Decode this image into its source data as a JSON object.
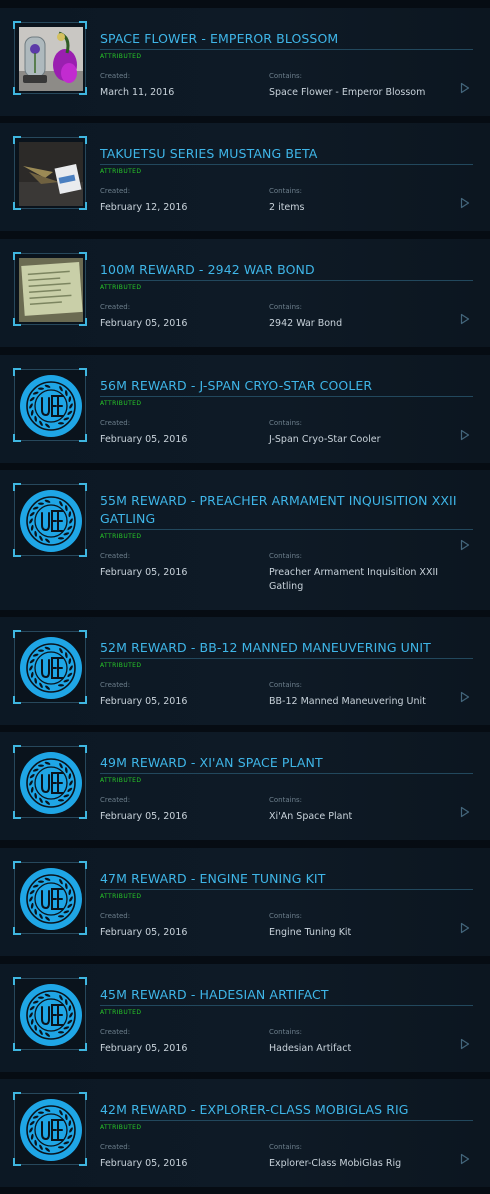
{
  "labels": {
    "status": "ATTRIBUTED",
    "created": "Created:",
    "contains": "Contains:"
  },
  "icons": {
    "expand": "play-arrow-icon",
    "uee_logo": "uee-emblem-icon"
  },
  "colors": {
    "title": "#3fb6e8",
    "status": "#28c928",
    "emblem": "#1fa6e6"
  },
  "items": [
    {
      "title": "SPACE FLOWER - EMPEROR BLOSSOM",
      "status": "ATTRIBUTED",
      "created": "March 11, 2016",
      "contains": "Space Flower - Emperor Blossom",
      "thumbnail": "flower-photo"
    },
    {
      "title": "TAKUETSU SERIES MUSTANG BETA",
      "status": "ATTRIBUTED",
      "created": "February 12, 2016",
      "contains": "2 items",
      "thumbnail": "model-ship-photo"
    },
    {
      "title": "100M REWARD - 2942 WAR BOND",
      "status": "ATTRIBUTED",
      "created": "February 05, 2016",
      "contains": "2942 War Bond",
      "thumbnail": "war-bond-photo"
    },
    {
      "title": "56M REWARD - J-SPAN CRYO-STAR COOLER",
      "status": "ATTRIBUTED",
      "created": "February 05, 2016",
      "contains": "J-Span Cryo-Star Cooler",
      "thumbnail": "uee-emblem"
    },
    {
      "title": "55M REWARD - PREACHER ARMAMENT INQUISITION XXII GATLING",
      "status": "ATTRIBUTED",
      "created": "February 05, 2016",
      "contains": "Preacher Armament Inquisition XXII Gatling",
      "thumbnail": "uee-emblem"
    },
    {
      "title": "52M REWARD - BB-12 MANNED MANEUVERING UNIT",
      "status": "ATTRIBUTED",
      "created": "February 05, 2016",
      "contains": "BB-12 Manned Maneuvering Unit",
      "thumbnail": "uee-emblem"
    },
    {
      "title": "49M REWARD - XI'AN SPACE PLANT",
      "status": "ATTRIBUTED",
      "created": "February 05, 2016",
      "contains": "Xi'An Space Plant",
      "thumbnail": "uee-emblem"
    },
    {
      "title": "47M REWARD - ENGINE TUNING KIT",
      "status": "ATTRIBUTED",
      "created": "February 05, 2016",
      "contains": "Engine Tuning Kit",
      "thumbnail": "uee-emblem"
    },
    {
      "title": "45M REWARD - HADESIAN ARTIFACT",
      "status": "ATTRIBUTED",
      "created": "February 05, 2016",
      "contains": "Hadesian Artifact",
      "thumbnail": "uee-emblem"
    },
    {
      "title": "42M REWARD - EXPLORER-CLASS MOBIGLAS RIG",
      "status": "ATTRIBUTED",
      "created": "February 05, 2016",
      "contains": "Explorer-Class MobiGlas Rig",
      "thumbnail": "uee-emblem"
    }
  ]
}
